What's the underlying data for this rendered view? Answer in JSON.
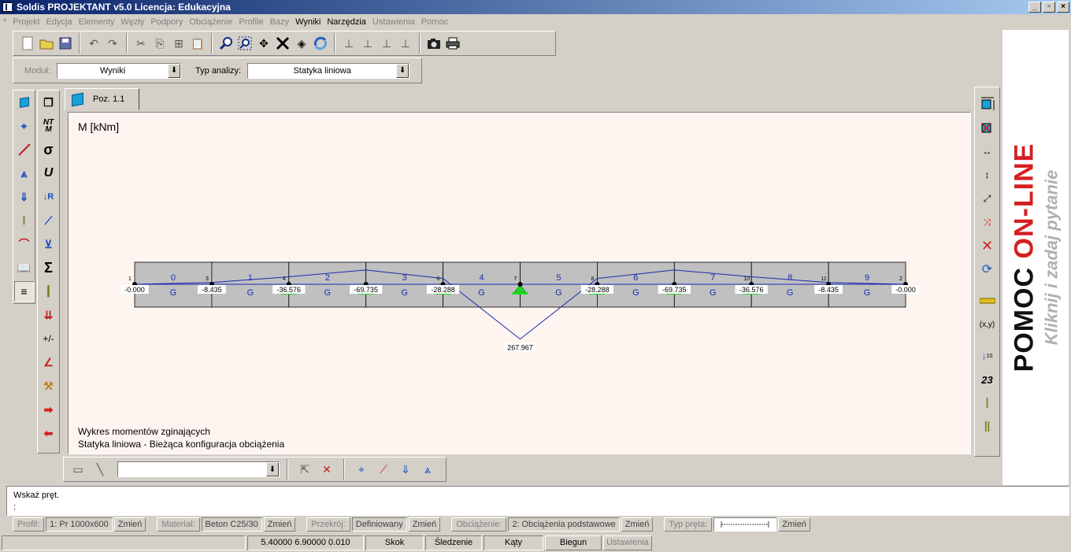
{
  "window": {
    "title": "Soldis PROJEKTANT v5.0 Licencja: Edukacyjna",
    "btn_min": "_",
    "btn_restore": "▫",
    "btn_close": "×"
  },
  "menu": [
    {
      "label": "*",
      "active": false
    },
    {
      "label": "Projekt",
      "active": false
    },
    {
      "label": "Edycja",
      "active": false
    },
    {
      "label": "Elementy",
      "active": false
    },
    {
      "label": "Węzły",
      "active": false
    },
    {
      "label": "Podpory",
      "active": false
    },
    {
      "label": "Obciążenie",
      "active": false
    },
    {
      "label": "Profile",
      "active": false
    },
    {
      "label": "Bazy",
      "active": false
    },
    {
      "label": "Wyniki",
      "active": true
    },
    {
      "label": "Narzędzia",
      "active": true
    },
    {
      "label": "Ustawienia",
      "active": false
    },
    {
      "label": "Pomoc",
      "active": false
    }
  ],
  "module_bar": {
    "module_label": "Moduł:",
    "module_value": "Wyniki",
    "analysis_label": "Typ analizy:",
    "analysis_value": "Statyka liniowa"
  },
  "tabs": [
    {
      "label": "Poz. 1.1"
    }
  ],
  "canvas": {
    "unit_label": "M [kNm]",
    "caption_line1": "Wykres momentów zginających",
    "caption_line2": "Statyka liniowa - Bieżąca konfiguracja obciążenia"
  },
  "beam": {
    "element_numbers": [
      "0",
      "1",
      "2",
      "3",
      "4",
      "5",
      "6",
      "7",
      "8",
      "9"
    ],
    "element_label": "G",
    "nodes": [
      {
        "id": "1",
        "value": "-0.000",
        "support": false
      },
      {
        "id": "3",
        "value": "-8.435",
        "support": false
      },
      {
        "id": "4",
        "value": "-36.576",
        "support": true
      },
      {
        "id": "",
        "value": "-69.735",
        "support": true
      },
      {
        "id": "6",
        "value": "-28.288",
        "support": true
      },
      {
        "id": "7",
        "value": "267.967",
        "support": true
      },
      {
        "id": "8",
        "value": "-28.288",
        "support": true
      },
      {
        "id": "",
        "value": "-69.735",
        "support": true
      },
      {
        "id": "10",
        "value": "-36.576",
        "support": true
      },
      {
        "id": "11",
        "value": "-8.435",
        "support": false
      },
      {
        "id": "2",
        "value": "-0.000",
        "support": false
      }
    ],
    "moments": [
      0.0,
      -8.435,
      -36.576,
      -69.735,
      -28.288,
      267.967,
      -28.288,
      -69.735,
      -36.576,
      -8.435,
      0.0
    ]
  },
  "pomoc": {
    "part1": "POMOC",
    "part2": "ON-LINE",
    "subtitle": "Kliknij i zadaj pytanie"
  },
  "command": {
    "line1": "Wskaż pręt.",
    "line2": ":"
  },
  "properties": {
    "profil_label": "Profil:",
    "profil_value": "1: Pr 1000x600",
    "profil_btn": "Zmień",
    "material_label": "Materiał:",
    "material_value": "Beton C25/30",
    "material_btn": "Zmień",
    "przekroj_label": "Przekrój:",
    "przekroj_value": "Definiowany",
    "przekroj_btn": "Zmień",
    "obciazenie_label": "Obciążenie:",
    "obciazenie_value": "2: Obciążenia podstawowe",
    "obciazenie_btn": "Zmień",
    "typ_label": "Typ pręta:",
    "typ_btn": "Zmień"
  },
  "status": {
    "coords": "5.40000  6.90000  0.010",
    "skok": "Skok",
    "sledzenie": "Śledzenie",
    "katy": "Kąty",
    "biegun": "Biegun",
    "ustawienia": "Ustawienia"
  },
  "right_toolbar": {
    "label_xy": "(x,y)",
    "label_23": "23",
    "label_10": "10"
  },
  "left_toolbar": {
    "nt": "NT",
    "m": "M",
    "sigma": "σ",
    "u": "U",
    "rsum": "Σ",
    "pm": "+/-",
    "r": "R"
  }
}
